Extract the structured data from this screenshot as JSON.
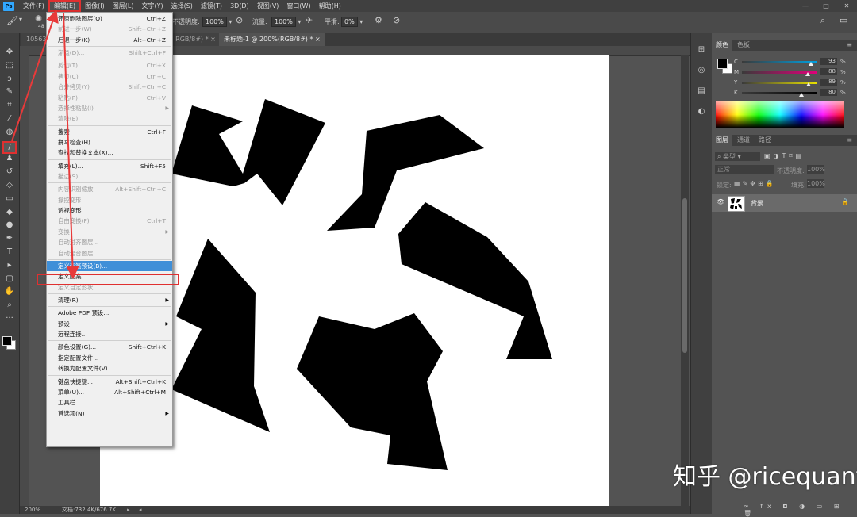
{
  "menubar": {
    "items": [
      "文件(F)",
      "编辑(E)",
      "图像(I)",
      "图层(L)",
      "文字(Y)",
      "选择(S)",
      "滤镜(T)",
      "3D(D)",
      "视图(V)",
      "窗口(W)",
      "帮助(H)"
    ],
    "active_index": 1
  },
  "window_controls": [
    "—",
    "□",
    "✕"
  ],
  "options": {
    "opacity_label": "不透明度:",
    "opacity_value": "100%",
    "flow_label": "流量:",
    "flow_value": "100%",
    "smooth_label": "平滑:",
    "smooth_value": "0%",
    "brush_size": "48"
  },
  "tabs": [
    {
      "label": "105635",
      "active": false
    },
    {
      "label": "3, RGB/8#) * ×",
      "active": false
    },
    {
      "label": "未标题-1 @ 200%(RGB/8#) * ×",
      "active": true
    }
  ],
  "status": {
    "zoom": "200%",
    "doc": "文档:732.4K/676.7K"
  },
  "panels": {
    "color_tabs": [
      "颜色",
      "色板"
    ],
    "cmyk": [
      {
        "label": "C",
        "value": "93",
        "color": "#00a0e0"
      },
      {
        "label": "M",
        "value": "88",
        "color": "#e0007a"
      },
      {
        "label": "Y",
        "value": "89",
        "color": "#e8e000"
      },
      {
        "label": "K",
        "value": "80",
        "color": "#000000"
      }
    ],
    "pct": "%",
    "layer_tabs": [
      "图层",
      "通道",
      "路径"
    ],
    "kind_label": "类型",
    "blend_mode": "正常",
    "opacity_label": "不透明度:",
    "opacity_value": "100%",
    "lock_label": "锁定:",
    "fill_label": "填充:",
    "fill_value": "100%",
    "layer_name": "背景"
  },
  "edit_menu": {
    "items": [
      {
        "type": "item",
        "label": "还原删除图层(O)",
        "shortcut": "Ctrl+Z",
        "state": "enabled"
      },
      {
        "type": "item",
        "label": "前进一步(W)",
        "shortcut": "Shift+Ctrl+Z",
        "state": "disabled"
      },
      {
        "type": "item",
        "label": "后退一步(K)",
        "shortcut": "Alt+Ctrl+Z",
        "state": "enabled"
      },
      {
        "type": "sep"
      },
      {
        "type": "item",
        "label": "渐隐(D)...",
        "shortcut": "Shift+Ctrl+F",
        "state": "disabled"
      },
      {
        "type": "sep"
      },
      {
        "type": "item",
        "label": "剪切(T)",
        "shortcut": "Ctrl+X",
        "state": "disabled"
      },
      {
        "type": "item",
        "label": "拷贝(C)",
        "shortcut": "Ctrl+C",
        "state": "disabled"
      },
      {
        "type": "item",
        "label": "合并拷贝(Y)",
        "shortcut": "Shift+Ctrl+C",
        "state": "disabled"
      },
      {
        "type": "item",
        "label": "粘贴(P)",
        "shortcut": "Ctrl+V",
        "state": "disabled"
      },
      {
        "type": "item",
        "label": "选择性粘贴(I)",
        "shortcut": "",
        "state": "disabled",
        "submenu": true
      },
      {
        "type": "item",
        "label": "清除(E)",
        "shortcut": "",
        "state": "disabled"
      },
      {
        "type": "sep"
      },
      {
        "type": "item",
        "label": "搜索",
        "shortcut": "Ctrl+F",
        "state": "enabled"
      },
      {
        "type": "item",
        "label": "拼写检查(H)...",
        "shortcut": "",
        "state": "enabled"
      },
      {
        "type": "item",
        "label": "查找和替换文本(X)...",
        "shortcut": "",
        "state": "enabled"
      },
      {
        "type": "sep"
      },
      {
        "type": "item",
        "label": "填充(L)...",
        "shortcut": "Shift+F5",
        "state": "enabled"
      },
      {
        "type": "item",
        "label": "描边(S)...",
        "shortcut": "",
        "state": "disabled"
      },
      {
        "type": "sep"
      },
      {
        "type": "item",
        "label": "内容识别缩放",
        "shortcut": "Alt+Shift+Ctrl+C",
        "state": "disabled"
      },
      {
        "type": "item",
        "label": "操控变形",
        "shortcut": "",
        "state": "disabled"
      },
      {
        "type": "item",
        "label": "透视变形",
        "shortcut": "",
        "state": "enabled"
      },
      {
        "type": "item",
        "label": "自由变换(F)",
        "shortcut": "Ctrl+T",
        "state": "disabled"
      },
      {
        "type": "item",
        "label": "变换",
        "shortcut": "",
        "state": "disabled",
        "submenu": true
      },
      {
        "type": "item",
        "label": "自动对齐图层...",
        "shortcut": "",
        "state": "disabled"
      },
      {
        "type": "item",
        "label": "自动混合图层...",
        "shortcut": "",
        "state": "disabled"
      },
      {
        "type": "sep"
      },
      {
        "type": "item",
        "label": "定义画笔预设(B)...",
        "shortcut": "",
        "state": "highlighted"
      },
      {
        "type": "item",
        "label": "定义图案...",
        "shortcut": "",
        "state": "enabled"
      },
      {
        "type": "item",
        "label": "定义自定形状...",
        "shortcut": "",
        "state": "disabled"
      },
      {
        "type": "sep"
      },
      {
        "type": "item",
        "label": "清理(R)",
        "shortcut": "",
        "state": "enabled",
        "submenu": true
      },
      {
        "type": "sep"
      },
      {
        "type": "item",
        "label": "Adobe PDF 预设...",
        "shortcut": "",
        "state": "enabled"
      },
      {
        "type": "item",
        "label": "预设",
        "shortcut": "",
        "state": "enabled",
        "submenu": true
      },
      {
        "type": "item",
        "label": "远程连接...",
        "shortcut": "",
        "state": "enabled"
      },
      {
        "type": "sep"
      },
      {
        "type": "item",
        "label": "颜色设置(G)...",
        "shortcut": "Shift+Ctrl+K",
        "state": "enabled"
      },
      {
        "type": "item",
        "label": "指定配置文件...",
        "shortcut": "",
        "state": "enabled"
      },
      {
        "type": "item",
        "label": "转换为配置文件(V)...",
        "shortcut": "",
        "state": "enabled"
      },
      {
        "type": "sep"
      },
      {
        "type": "item",
        "label": "键盘快捷键...",
        "shortcut": "Alt+Shift+Ctrl+K",
        "state": "enabled"
      },
      {
        "type": "item",
        "label": "菜单(U)...",
        "shortcut": "Alt+Shift+Ctrl+M",
        "state": "enabled"
      },
      {
        "type": "item",
        "label": "工具栏...",
        "shortcut": "",
        "state": "enabled"
      },
      {
        "type": "item",
        "label": "首选项(N)",
        "shortcut": "",
        "state": "enabled",
        "submenu": true
      }
    ]
  },
  "tools": [
    {
      "name": "move-tool-icon",
      "glyph": "✥"
    },
    {
      "name": "marquee-tool-icon",
      "glyph": "⬚"
    },
    {
      "name": "lasso-tool-icon",
      "glyph": "ↄ"
    },
    {
      "name": "quick-select-tool-icon",
      "glyph": "✎"
    },
    {
      "name": "crop-tool-icon",
      "glyph": "⌗"
    },
    {
      "name": "eyedropper-tool-icon",
      "glyph": "⁄"
    },
    {
      "name": "healing-tool-icon",
      "glyph": "◍"
    },
    {
      "name": "brush-tool-icon",
      "glyph": "/"
    },
    {
      "name": "stamp-tool-icon",
      "glyph": "♟"
    },
    {
      "name": "history-brush-tool-icon",
      "glyph": "↺"
    },
    {
      "name": "eraser-tool-icon",
      "glyph": "◇"
    },
    {
      "name": "gradient-tool-icon",
      "glyph": "▭"
    },
    {
      "name": "blur-tool-icon",
      "glyph": "◆"
    },
    {
      "name": "dodge-tool-icon",
      "glyph": "●"
    },
    {
      "name": "pen-tool-icon",
      "glyph": "✒"
    },
    {
      "name": "type-tool-icon",
      "glyph": "T"
    },
    {
      "name": "path-select-tool-icon",
      "glyph": "▸"
    },
    {
      "name": "shape-tool-icon",
      "glyph": "▢"
    },
    {
      "name": "hand-tool-icon",
      "glyph": "✋"
    },
    {
      "name": "zoom-tool-icon",
      "glyph": "⌕"
    },
    {
      "name": "more-tools-icon",
      "glyph": "···"
    }
  ],
  "watermark": "知乎 @ricequant"
}
